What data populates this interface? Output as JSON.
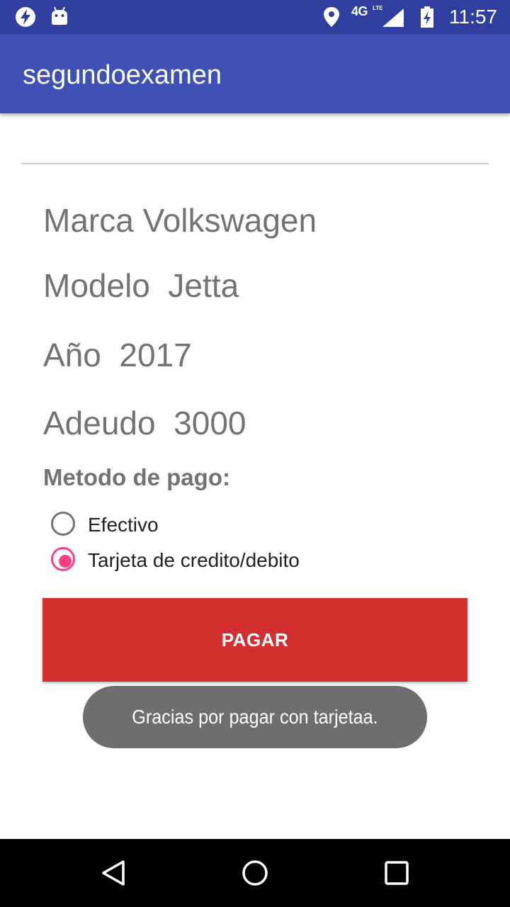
{
  "status_bar": {
    "time": "11:57",
    "network": "4G",
    "network_sub": "LTE",
    "icons": [
      "bolt-icon",
      "android-icon",
      "location-icon",
      "signal-icon",
      "battery-charging-icon"
    ]
  },
  "app_bar": {
    "title": "segundoexamen",
    "color": "#3f51b5",
    "status_color": "#303f9f"
  },
  "vehicle": {
    "marca": "Marca Volkswagen",
    "modelo": "Modelo  Jetta",
    "anio": "Año  2017",
    "adeudo": "Adeudo  3000"
  },
  "payment": {
    "label": "Metodo de pago:",
    "options": [
      {
        "label": "Efectivo",
        "selected": false
      },
      {
        "label": "Tarjeta de credito/debito",
        "selected": true
      }
    ],
    "accent": "#ff4081"
  },
  "button": {
    "label": "PAGAR",
    "color": "#d32f2f"
  },
  "toast": {
    "message": "Gracias por pagar con tarjetaa."
  },
  "nav_bar": {
    "icons": [
      "back-icon",
      "home-icon",
      "recent-apps-icon"
    ]
  }
}
